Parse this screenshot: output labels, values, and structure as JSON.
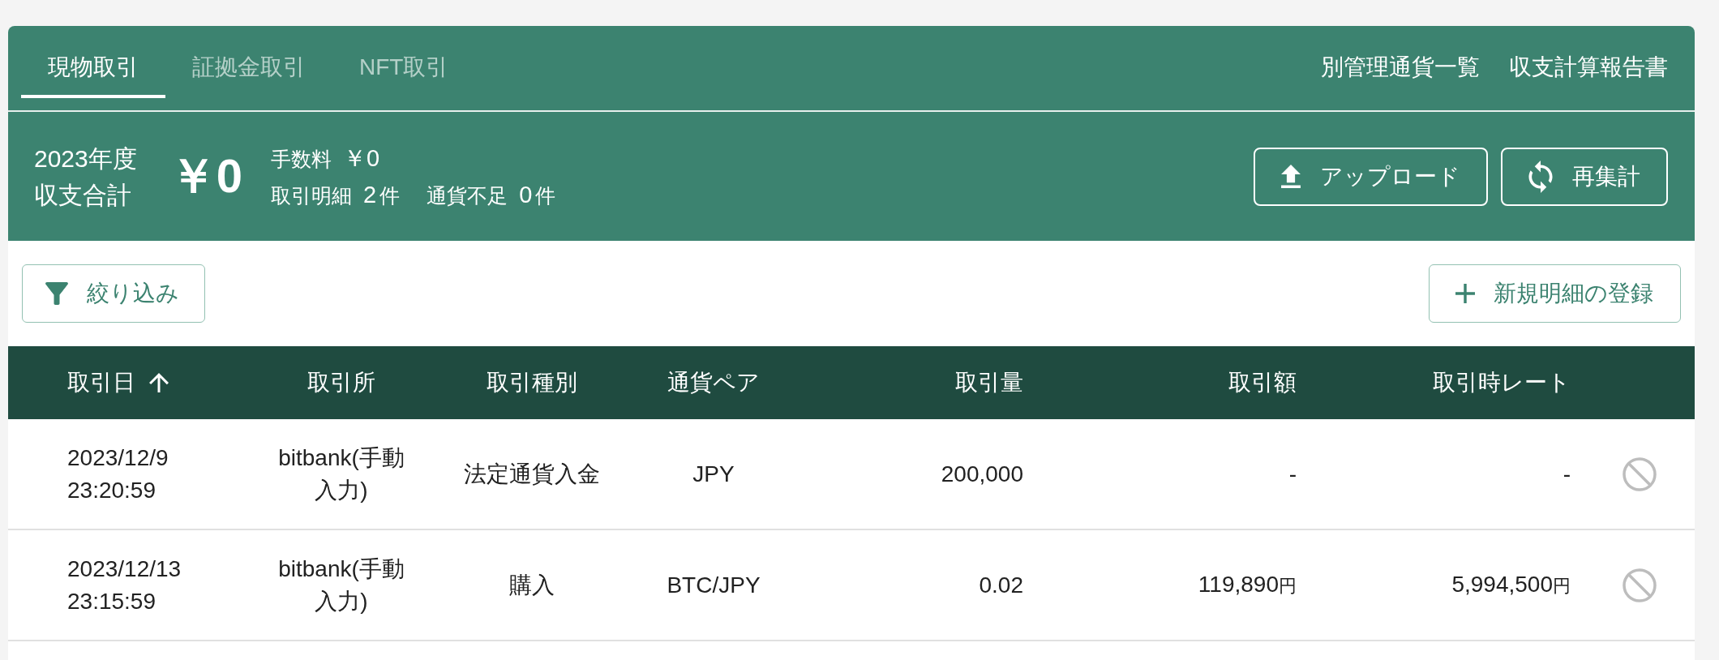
{
  "tabs": [
    {
      "label": "現物取引",
      "selected": true
    },
    {
      "label": "証拠金取引",
      "selected": false
    },
    {
      "label": "NFT取引",
      "selected": false
    }
  ],
  "header_links": [
    "別管理通貨一覧",
    "収支計算報告書"
  ],
  "summary": {
    "period": "2023年度",
    "title": "収支合計",
    "total": "￥0",
    "fee": {
      "label": "手数料",
      "value": "￥0"
    },
    "counts": [
      {
        "label": "取引明細",
        "value": "2",
        "unit": "件"
      },
      {
        "label": "通貨不足",
        "value": "0",
        "unit": "件"
      }
    ],
    "buttons": [
      {
        "kind": "upload",
        "label": "アップロード"
      },
      {
        "kind": "refresh",
        "label": "再集計"
      }
    ]
  },
  "toolbar": {
    "filter_button": "絞り込み",
    "add_button": "新規明細の登録"
  },
  "table": {
    "columns": [
      {
        "label": "取引日",
        "sorted": true
      },
      {
        "label": "取引所",
        "sorted": false
      },
      {
        "label": "取引種別",
        "sorted": false
      },
      {
        "label": "通貨ペア",
        "sorted": false
      },
      {
        "label": "取引量",
        "sorted": false
      },
      {
        "label": "取引額",
        "sorted": false
      },
      {
        "label": "取引時レート",
        "sorted": false
      }
    ],
    "rows": [
      {
        "date": "2023/12/9",
        "time": "23:20:59",
        "exchange": "bitbank(手動入力)",
        "type": "法定通貨入金",
        "pair": "JPY",
        "quantity": "200,000",
        "amount": {
          "value": "-"
        },
        "rate": {
          "value": "-"
        }
      },
      {
        "date": "2023/12/13",
        "time": "23:15:59",
        "exchange": "bitbank(手動入力)",
        "type": "購入",
        "pair": "BTC/JPY",
        "quantity": "0.02",
        "amount": {
          "value": "119,890",
          "unit": "円"
        },
        "rate": {
          "value": "5,994,500",
          "unit": "円"
        }
      }
    ]
  }
}
